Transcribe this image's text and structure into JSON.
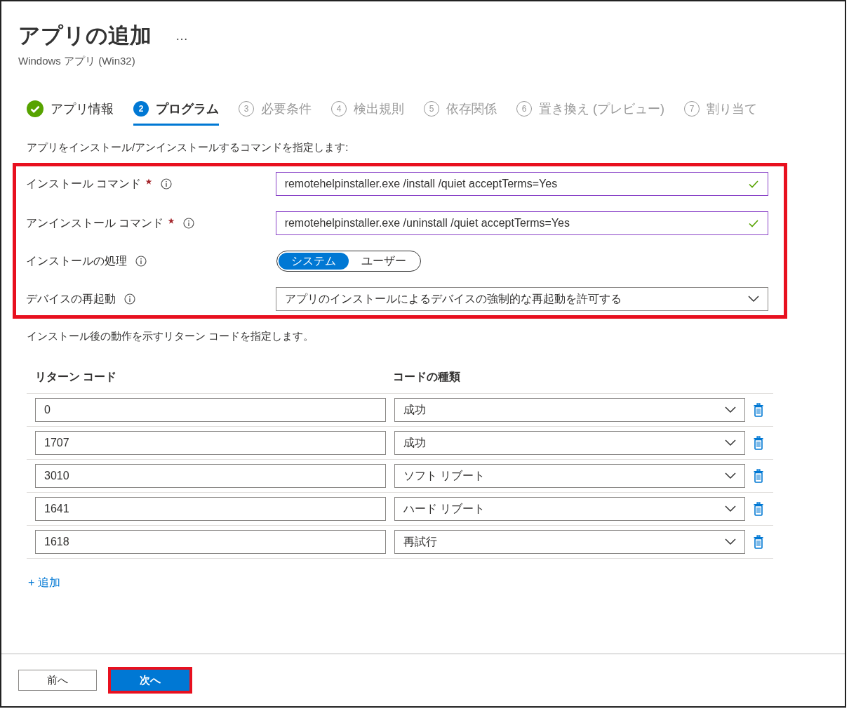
{
  "header": {
    "title": "アプリの追加",
    "more": "…",
    "subtitle": "Windows アプリ (Win32)"
  },
  "steps": [
    {
      "kind": "done",
      "label": "アプリ情報",
      "selected": false
    },
    {
      "kind": "current",
      "number": "2",
      "label": "プログラム",
      "selected": true
    },
    {
      "kind": "pending",
      "number": "3",
      "label": "必要条件",
      "selected": false
    },
    {
      "kind": "pending",
      "number": "4",
      "label": "検出規則",
      "selected": false
    },
    {
      "kind": "pending",
      "number": "5",
      "label": "依存関係",
      "selected": false
    },
    {
      "kind": "pending",
      "number": "6",
      "label": "置き換え (プレビュー)",
      "selected": false
    },
    {
      "kind": "pending",
      "number": "7",
      "label": "割り当て",
      "selected": false
    }
  ],
  "intro": "アプリをインストール/アンインストールするコマンドを指定します:",
  "fields": [
    {
      "kind": "text",
      "label": "インストール コマンド",
      "required": true,
      "value": "remotehelpinstaller.exe /install /quiet acceptTerms=Yes",
      "valid": true
    },
    {
      "kind": "text",
      "label": "アンインストール コマンド",
      "required": true,
      "value": "remotehelpinstaller.exe /uninstall /quiet acceptTerms=Yes",
      "valid": true
    },
    {
      "kind": "toggle",
      "label": "インストールの処理",
      "required": false,
      "options": [
        {
          "label": "システム",
          "selected": true
        },
        {
          "label": "ユーザー",
          "selected": false
        }
      ]
    },
    {
      "kind": "select",
      "label": "デバイスの再起動",
      "required": false,
      "value": "アプリのインストールによるデバイスの強制的な再起動を許可する"
    }
  ],
  "return_intro": "インストール後の動作を示すリターン コードを指定します。",
  "table": {
    "columns": [
      "リターン コード",
      "コードの種類"
    ],
    "rows": [
      {
        "code": "0",
        "type": "成功"
      },
      {
        "code": "1707",
        "type": "成功"
      },
      {
        "code": "3010",
        "type": "ソフト リブート"
      },
      {
        "code": "1641",
        "type": "ハード リブート"
      },
      {
        "code": "1618",
        "type": "再試行"
      }
    ]
  },
  "add_link": "+ 追加",
  "buttons": [
    {
      "label": "前へ",
      "kind": "secondary"
    },
    {
      "label": "次へ",
      "kind": "primary"
    }
  ]
}
